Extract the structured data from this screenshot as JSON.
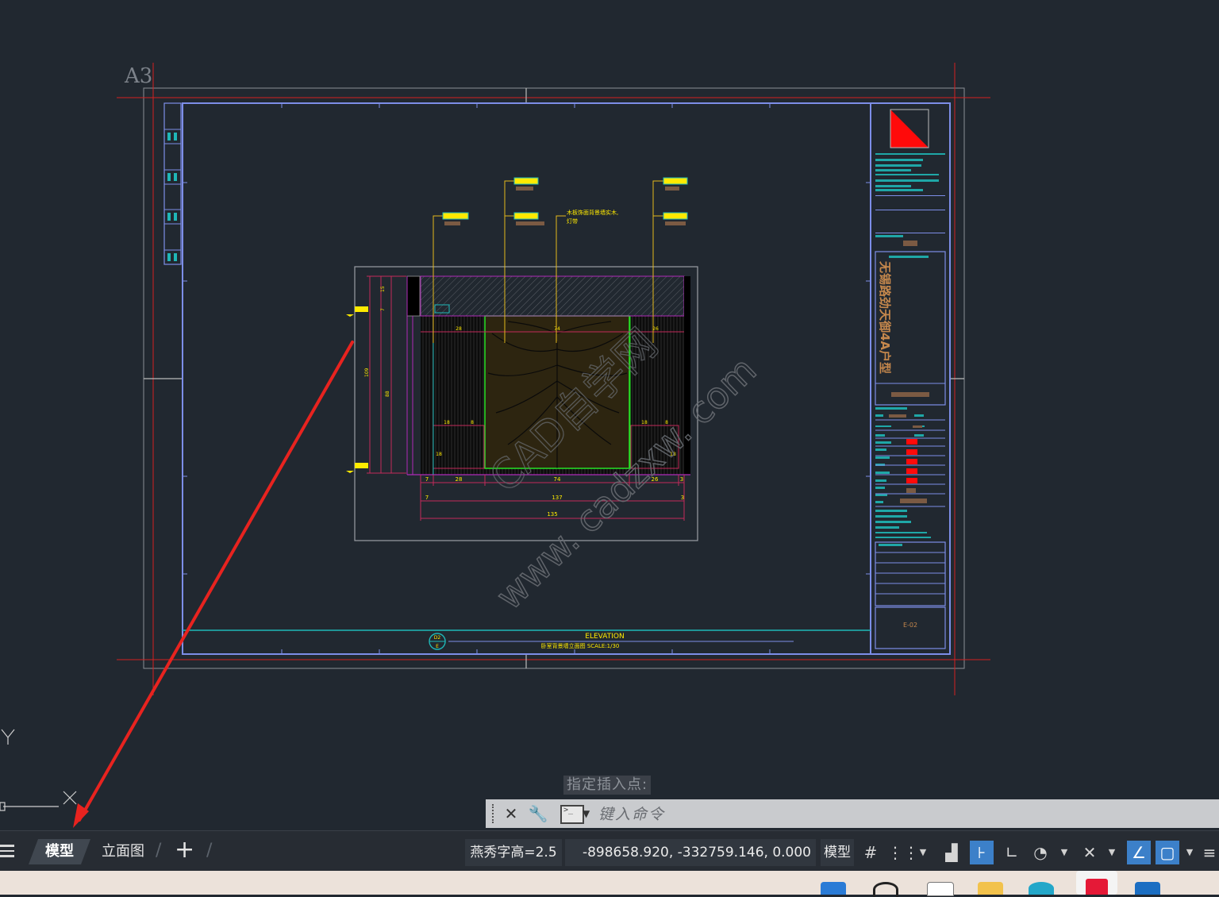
{
  "drawing": {
    "sheet_label": "A3",
    "watermark": "www. cadzxw. com",
    "watermark_cn": "CAD自学网",
    "elevation_title": "ELEVATION",
    "elevation_subtitle": "卧室背景墙立面图   SCALE:1/30",
    "elevation_tag_top": "D2",
    "elevation_tag_bottom": "E",
    "project_name": "无锡路劲天御\n4A户型",
    "sheet_no": "E-02",
    "note": "木板饰面背景墙实木,\n灯带",
    "dims_bottom": [
      "7",
      "28",
      "74",
      "26",
      "3"
    ],
    "dim_total_1": "137",
    "dim_total_2": "135",
    "ucs_y": "Y",
    "ucs_x": "X"
  },
  "command": {
    "prompt": "指定插入点:",
    "placeholder": "键入命令",
    "close_icon": "close-icon",
    "customize_icon": "wrench-icon"
  },
  "status": {
    "tabs": [
      {
        "label": "模型",
        "active": true
      },
      {
        "label": "立面图",
        "active": false
      }
    ],
    "text_height": "燕秀字高=2.5",
    "coordinates": "-898658.920, -332759.146, 0.000",
    "model_button": "模型"
  },
  "colors": {
    "background": "#212830",
    "annotation_arrow": "#e8231f",
    "frame": "#7d8ee8",
    "highlight": "#3c80c9"
  }
}
